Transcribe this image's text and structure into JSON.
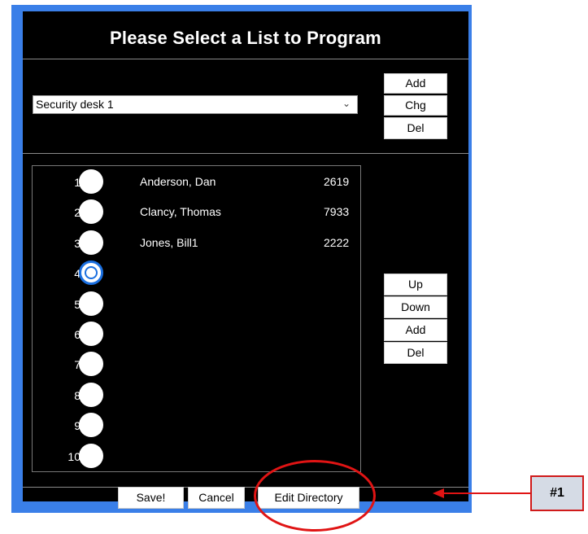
{
  "dialog": {
    "title": "Please Select a List to Program",
    "list_select": {
      "value": "Security desk 1"
    },
    "list_buttons": {
      "add": "Add",
      "chg": "Chg",
      "del": "Del"
    },
    "entry_buttons": {
      "up": "Up",
      "down": "Down",
      "add": "Add",
      "del": "Del"
    },
    "entries": [
      {
        "num": "1",
        "name": "Anderson, Dan",
        "ext": "2619",
        "selected": false
      },
      {
        "num": "2",
        "name": "Clancy, Thomas",
        "ext": "7933",
        "selected": false
      },
      {
        "num": "3",
        "name": "Jones, Bill1",
        "ext": "2222",
        "selected": false
      },
      {
        "num": "4",
        "name": "",
        "ext": "",
        "selected": true
      },
      {
        "num": "5",
        "name": "",
        "ext": "",
        "selected": false
      },
      {
        "num": "6",
        "name": "",
        "ext": "",
        "selected": false
      },
      {
        "num": "7",
        "name": "",
        "ext": "",
        "selected": false
      },
      {
        "num": "8",
        "name": "",
        "ext": "",
        "selected": false
      },
      {
        "num": "9",
        "name": "",
        "ext": "",
        "selected": false
      },
      {
        "num": "10",
        "name": "",
        "ext": "",
        "selected": false
      }
    ],
    "footer": {
      "save": "Save!",
      "cancel": "Cancel",
      "edit_directory": "Edit Directory"
    }
  },
  "annotation": {
    "callout_label": "#1",
    "accent_color": "#e01414",
    "frame_color": "#3a7fe8"
  }
}
